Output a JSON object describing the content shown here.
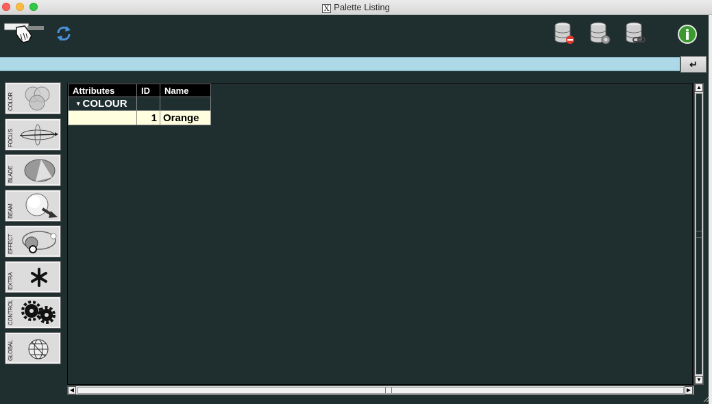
{
  "window": {
    "title": "Palette Listing",
    "x_logo": "X"
  },
  "toolbar": {
    "hand_icon": "pointing-hand-icon",
    "refresh_icon": "refresh-icon",
    "db_icons": [
      "database-remove-icon",
      "database-settings-icon",
      "database-link-icon"
    ],
    "info_icon": "info-icon",
    "accent_info": "#3a9a2e",
    "accent_refresh": "#3a7fc4"
  },
  "command": {
    "value": "",
    "enter_label": "↵"
  },
  "side_buttons": [
    {
      "label": "COLOR",
      "icon": "color-circles-icon"
    },
    {
      "label": "FOCUS",
      "icon": "focus-ellipse-icon"
    },
    {
      "label": "BLADE",
      "icon": "blade-icon"
    },
    {
      "label": "BEAM",
      "icon": "beam-arrow-icon"
    },
    {
      "label": "EFFECT",
      "icon": "effect-orbit-icon"
    },
    {
      "label": "EXTRA",
      "icon": "asterisk-icon"
    },
    {
      "label": "CONTROL",
      "icon": "gears-icon"
    },
    {
      "label": "GLOBAL",
      "icon": "globe-icon"
    }
  ],
  "table": {
    "columns": [
      "Attributes",
      "ID",
      "Name"
    ],
    "group": {
      "toggle": "▾",
      "label": "COLOUR"
    },
    "rows": [
      {
        "attribute": "",
        "id": "1",
        "name": "Orange"
      }
    ],
    "row_color": "#ffffe0",
    "bg_color": "#1f2e2e"
  }
}
